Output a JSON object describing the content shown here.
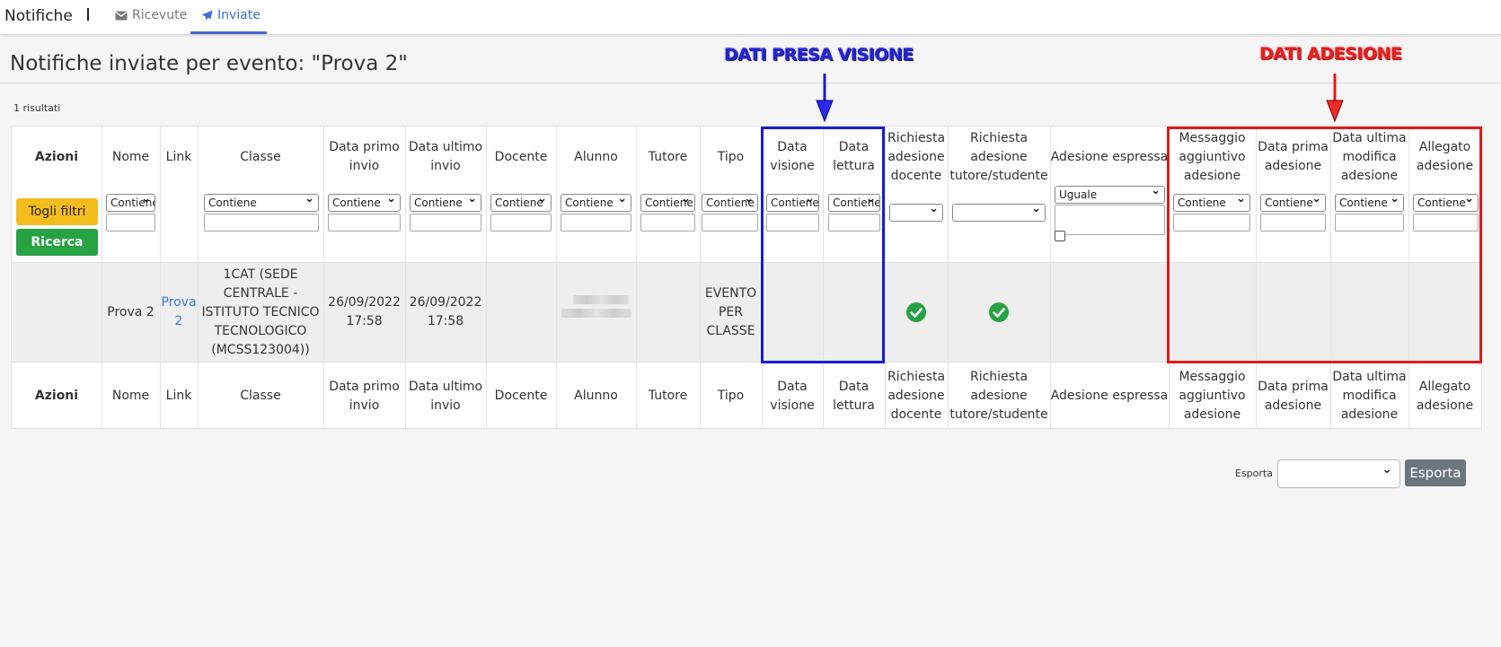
{
  "topbar": {
    "app_title": "Notifiche",
    "tabs": [
      {
        "label": "Ricevute",
        "icon": "envelope-icon",
        "active": false
      },
      {
        "label": "Inviate",
        "icon": "paper-plane-icon",
        "active": true
      }
    ]
  },
  "page": {
    "title": "Notifiche inviate per evento: \"Prova 2\"",
    "results_count": "1 risultati"
  },
  "table": {
    "columns": {
      "azioni": "Azioni",
      "nome": "Nome",
      "link": "Link",
      "classe": "Classe",
      "data_primo_invio": "Data primo invio",
      "data_ultimo_invio": "Data ultimo invio",
      "docente": "Docente",
      "alunno": "Alunno",
      "tutore": "Tutore",
      "tipo": "Tipo",
      "data_visione": "Data visione",
      "data_lettura": "Data lettura",
      "richiesta_docente": "Richiesta adesione docente",
      "richiesta_tutore": "Richiesta adesione tutore/studente",
      "adesione_espressa": "Adesione espressa",
      "messaggio_aggiuntivo": "Messaggio aggiuntivo adesione",
      "data_prima_adesione": "Data prima adesione",
      "data_ultima_modifica": "Data ultima modifica adesione",
      "allegato_adesione": "Allegato adesione"
    },
    "filters": {
      "contiene": "Contiene",
      "uguale": "Uguale",
      "togli_filtri": "Togli filtri",
      "ricerca": "Ricerca"
    },
    "row": {
      "nome": "Prova 2",
      "link": "Prova 2",
      "classe": "1CAT (SEDE CENTRALE - ISTITUTO TECNICO TECNOLOGICO (MCSS123004))",
      "data_primo_invio": "26/09/2022 17:58",
      "data_ultimo_invio": "26/09/2022 17:58",
      "tipo": "EVENTO PER CLASSE",
      "richiesta_docente": true,
      "richiesta_tutore": true
    }
  },
  "annotations": {
    "blue_label": "DATI PRESA VISIONE",
    "red_label": "DATI ADESIONE",
    "blue_color": "#1a1ad6",
    "red_color": "#e01a1a"
  },
  "export": {
    "label": "Esporta",
    "button": "Esporta"
  },
  "colors": {
    "accent": "#4966d1",
    "warning_button": "#f5bc1d",
    "success_button": "#27a243",
    "secondary_button": "#6d757d",
    "check_green": "#27a243"
  }
}
